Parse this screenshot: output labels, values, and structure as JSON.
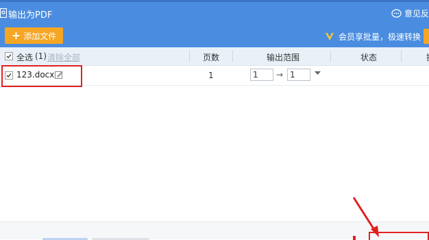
{
  "window": {
    "title": "输出为PDF",
    "feedback_label": "意见反"
  },
  "toolbar": {
    "add_file_label": "添加文件",
    "vip_text": "会员享批量，极速转换"
  },
  "table": {
    "columns": {
      "select_all": "全选",
      "count": "(1)",
      "clear_all": "清除全部",
      "pages": "页数",
      "range": "输出范围",
      "status": "状态",
      "op": "操"
    },
    "rows": [
      {
        "filename": "123.docx",
        "pages": "1",
        "range_from": "1",
        "range_arrow": "→",
        "range_to": "1",
        "checked": true
      }
    ]
  },
  "colors": {
    "header_blue": "#4a8de0",
    "accent_orange": "#f5a623",
    "highlight_red": "#e02020"
  }
}
